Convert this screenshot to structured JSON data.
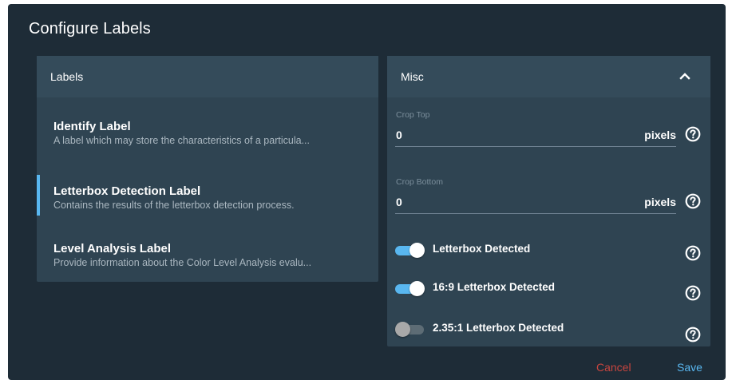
{
  "dialog": {
    "title": "Configure Labels"
  },
  "labels_panel": {
    "header": "Labels",
    "items": [
      {
        "title": "Identify Label",
        "description": "A label which may store the characteristics of a particula...",
        "selected": false
      },
      {
        "title": "Letterbox Detection Label",
        "description": "Contains the results of the letterbox detection process.",
        "selected": true
      },
      {
        "title": "Level Analysis Label",
        "description": "Provide information about the Color Level Analysis evalu...",
        "selected": false
      }
    ]
  },
  "misc_panel": {
    "header": "Misc",
    "expanded": true,
    "fields": [
      {
        "label": "Crop Top",
        "value": "0",
        "unit": "pixels"
      },
      {
        "label": "Crop Bottom",
        "value": "0",
        "unit": "pixels"
      }
    ],
    "toggles": [
      {
        "label": "Letterbox Detected",
        "on": true
      },
      {
        "label": "16:9 Letterbox Detected",
        "on": true
      },
      {
        "label": "2.35:1 Letterbox Detected",
        "on": false
      }
    ]
  },
  "footer": {
    "cancel_label": "Cancel",
    "save_label": "Save"
  },
  "colors": {
    "accent": "#59b7f0",
    "cancel": "#c7453f",
    "background": "#1e2c37",
    "panel": "#2f4452"
  },
  "icons": {
    "help": "help-circle-icon",
    "collapse": "chevron-up-icon"
  }
}
